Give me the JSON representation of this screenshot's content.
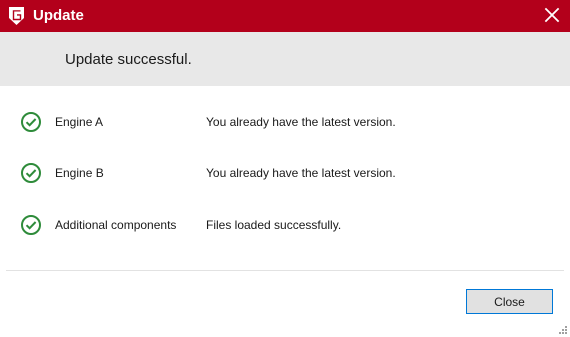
{
  "window": {
    "title": "Update",
    "logo_icon": "gdata-g-logo",
    "close_icon": "close-icon",
    "accent_color": "#b3001b"
  },
  "banner": {
    "message": "Update successful."
  },
  "components": [
    {
      "name": "Engine A",
      "status": "You already have the latest version.",
      "icon": "check-circle-icon"
    },
    {
      "name": "Engine B",
      "status": "You already have the latest version.",
      "icon": "check-circle-icon"
    },
    {
      "name": "Additional components",
      "status": "Files loaded successfully.",
      "icon": "check-circle-icon"
    }
  ],
  "footer": {
    "close_label": "Close"
  }
}
